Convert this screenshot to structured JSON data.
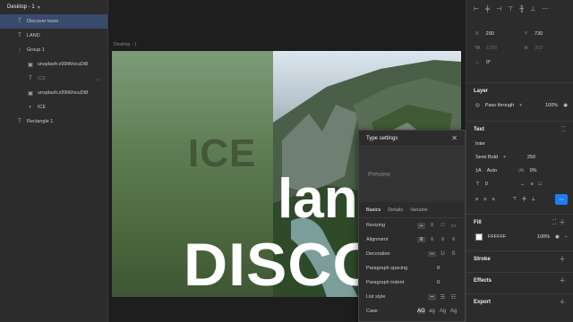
{
  "layers": {
    "page": "Desktop - 1",
    "items": [
      {
        "label": "Discover tours",
        "icon": "T",
        "selected": true
      },
      {
        "label": "LAND",
        "icon": "T"
      },
      {
        "label": "Group 1",
        "icon": "⋮"
      },
      {
        "label": "unsplash:z99iWocuDt8",
        "icon": "▣"
      },
      {
        "label": "ICE",
        "icon": "T"
      },
      {
        "label": "unsplash:z99iWocuDt8",
        "icon": "▣"
      },
      {
        "label": "ICE",
        "icon": "◐"
      },
      {
        "label": "Rectangle 1",
        "icon": "T"
      }
    ]
  },
  "canvas": {
    "frame_label": "Desktop - 1",
    "word_ice": "ICE",
    "word_land": "lan",
    "word_disco": "DISCO"
  },
  "popup": {
    "title": "Type settings",
    "preview": "Preview",
    "tabs": [
      "Basics",
      "Details",
      "Variable"
    ],
    "rows": {
      "resizing": "Resizing",
      "alignment": "Alignment",
      "decoration": "Decoration",
      "para_spacing": "Paragraph spacing",
      "para_spacing_val": "0",
      "para_indent": "Paragraph indent",
      "para_indent_val": "0",
      "list_style": "List style",
      "case": "Case"
    }
  },
  "props": {
    "x_label": "X",
    "x_val": "290",
    "y_label": "Y",
    "y_val": "730",
    "w_label": "W",
    "w_val": "2188",
    "h_label": "H",
    "h_val": "303",
    "r_val": "0°",
    "layer_title": "Layer",
    "layer_mode": "Pass through",
    "layer_opacity": "100%",
    "text_title": "Text",
    "font": "Inter",
    "weight": "Semi Bold",
    "size": "250",
    "line_height": "Auto",
    "letter_spacing": "0%",
    "para": "0",
    "fill_title": "Fill",
    "fill_hex": "FFFFFF",
    "fill_opacity": "100%",
    "stroke_title": "Stroke",
    "effects_title": "Effects",
    "export_title": "Export"
  }
}
